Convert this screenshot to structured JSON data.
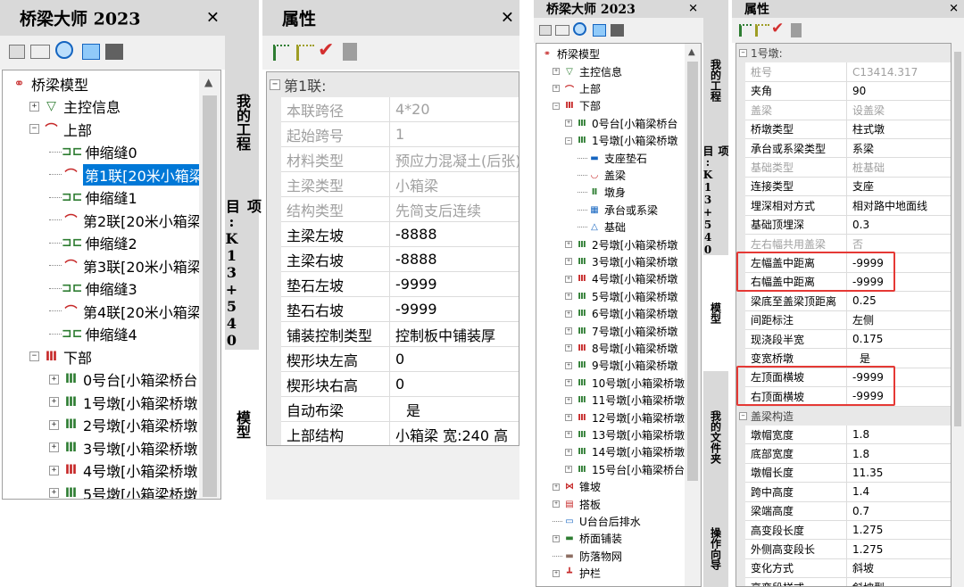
{
  "left": {
    "tree_title": "桥梁大师 2023",
    "props_title": "属性",
    "close": "✕",
    "tabs": [
      "我的工程",
      "项目:K13+540",
      "模型"
    ],
    "tree": [
      {
        "label": "桥梁模型",
        "icon": "bridge-model-icon",
        "glyph": "⚭",
        "color": "#c62828",
        "level": 0,
        "exp": ""
      },
      {
        "label": "主控信息",
        "icon": "main-control-icon",
        "glyph": "▽",
        "color": "#2e7d32",
        "level": 1,
        "exp": "+"
      },
      {
        "label": "上部",
        "icon": "superstructure-icon",
        "glyph": "⌒",
        "color": "#c62828",
        "level": 1,
        "exp": "−"
      },
      {
        "label": "伸缩缝0",
        "icon": "expansion-joint-icon",
        "glyph": "⊐⊏",
        "color": "#2e7d32",
        "level": 2,
        "exp": ""
      },
      {
        "label": "第1联[20米小箱梁",
        "icon": "span-icon",
        "glyph": "⌒",
        "color": "#c62828",
        "level": 2,
        "exp": "",
        "selected": true
      },
      {
        "label": "伸缩缝1",
        "icon": "expansion-joint-icon",
        "glyph": "⊐⊏",
        "color": "#2e7d32",
        "level": 2,
        "exp": ""
      },
      {
        "label": "第2联[20米小箱梁",
        "icon": "span-icon",
        "glyph": "⌒",
        "color": "#c62828",
        "level": 2,
        "exp": ""
      },
      {
        "label": "伸缩缝2",
        "icon": "expansion-joint-icon",
        "glyph": "⊐⊏",
        "color": "#2e7d32",
        "level": 2,
        "exp": ""
      },
      {
        "label": "第3联[20米小箱梁",
        "icon": "span-icon",
        "glyph": "⌒",
        "color": "#c62828",
        "level": 2,
        "exp": ""
      },
      {
        "label": "伸缩缝3",
        "icon": "expansion-joint-icon",
        "glyph": "⊐⊏",
        "color": "#2e7d32",
        "level": 2,
        "exp": ""
      },
      {
        "label": "第4联[20米小箱梁",
        "icon": "span-icon",
        "glyph": "⌒",
        "color": "#c62828",
        "level": 2,
        "exp": ""
      },
      {
        "label": "伸缩缝4",
        "icon": "expansion-joint-icon",
        "glyph": "⊐⊏",
        "color": "#2e7d32",
        "level": 2,
        "exp": ""
      },
      {
        "label": "下部",
        "icon": "substructure-icon",
        "glyph": "Ⅲ",
        "color": "#c62828",
        "level": 1,
        "exp": "−"
      },
      {
        "label": "0号台[小箱梁桥台",
        "icon": "abutment-icon",
        "glyph": "Ⅲ",
        "color": "#2e7d32",
        "level": 2,
        "exp": "+"
      },
      {
        "label": "1号墩[小箱梁桥墩",
        "icon": "pier-icon",
        "glyph": "Ⅲ",
        "color": "#2e7d32",
        "level": 2,
        "exp": "+"
      },
      {
        "label": "2号墩[小箱梁桥墩",
        "icon": "pier-icon",
        "glyph": "Ⅲ",
        "color": "#2e7d32",
        "level": 2,
        "exp": "+"
      },
      {
        "label": "3号墩[小箱梁桥墩",
        "icon": "pier-icon",
        "glyph": "Ⅲ",
        "color": "#2e7d32",
        "level": 2,
        "exp": "+"
      },
      {
        "label": "4号墩[小箱梁桥墩",
        "icon": "pier-icon",
        "glyph": "Ⅲ",
        "color": "#c62828",
        "level": 2,
        "exp": "+"
      },
      {
        "label": "5号墩[小箱梁桥墩",
        "icon": "pier-icon",
        "glyph": "Ⅲ",
        "color": "#2e7d32",
        "level": 2,
        "exp": "+"
      }
    ],
    "category": "第1联:",
    "props": [
      {
        "k": "本联跨径",
        "v": "4*20",
        "gray": true
      },
      {
        "k": "起始跨号",
        "v": "1",
        "gray": true
      },
      {
        "k": "材料类型",
        "v": "预应力混凝土(后张)",
        "gray": true
      },
      {
        "k": "主梁类型",
        "v": "小箱梁",
        "gray": true
      },
      {
        "k": "结构类型",
        "v": "先简支后连续",
        "gray": true
      },
      {
        "k": "主梁左坡",
        "v": "-8888",
        "gray": false
      },
      {
        "k": "主梁右坡",
        "v": "-8888",
        "gray": false
      },
      {
        "k": "垫石左坡",
        "v": "-9999",
        "gray": false
      },
      {
        "k": "垫石右坡",
        "v": "-9999",
        "gray": false
      },
      {
        "k": "铺装控制类型",
        "v": "控制板中铺装厚",
        "gray": false
      },
      {
        "k": "楔形块左高",
        "v": "0",
        "gray": false
      },
      {
        "k": "楔形块右高",
        "v": "0",
        "gray": false
      },
      {
        "k": "自动布梁",
        "v": "是",
        "gray": false,
        "center": true
      },
      {
        "k": "上部结构",
        "v": "小箱梁 宽:240 高",
        "gray": false
      }
    ]
  },
  "right": {
    "tree_title": "桥梁大师 2023",
    "props_title": "属性",
    "close": "✕",
    "tabs": [
      "我的工程",
      "项目:K13+540",
      "模型",
      "我的文件夹",
      "操作向导"
    ],
    "tree": [
      {
        "label": "桥梁模型",
        "icon": "bridge-model-icon",
        "glyph": "⚭",
        "color": "#c62828",
        "level": 0,
        "exp": ""
      },
      {
        "label": "主控信息",
        "icon": "main-control-icon",
        "glyph": "▽",
        "color": "#2e7d32",
        "level": 1,
        "exp": "+"
      },
      {
        "label": "上部",
        "icon": "superstructure-icon",
        "glyph": "⌒",
        "color": "#c62828",
        "level": 1,
        "exp": "+"
      },
      {
        "label": "下部",
        "icon": "substructure-icon",
        "glyph": "Ⅲ",
        "color": "#c62828",
        "level": 1,
        "exp": "−"
      },
      {
        "label": "0号台[小箱梁桥台",
        "icon": "abutment-icon",
        "glyph": "Ⅲ",
        "color": "#2e7d32",
        "level": 2,
        "exp": "+"
      },
      {
        "label": "1号墩[小箱梁桥墩",
        "icon": "pier-icon",
        "glyph": "Ⅲ",
        "color": "#2e7d32",
        "level": 2,
        "exp": "−"
      },
      {
        "label": "支座垫石",
        "icon": "bearing-pad-icon",
        "glyph": "▬",
        "color": "#1565c0",
        "level": 3,
        "exp": ""
      },
      {
        "label": "盖梁",
        "icon": "cap-beam-icon",
        "glyph": "◡",
        "color": "#c62828",
        "level": 3,
        "exp": ""
      },
      {
        "label": "墩身",
        "icon": "pier-body-icon",
        "glyph": "Ⅱ",
        "color": "#2e7d32",
        "level": 3,
        "exp": ""
      },
      {
        "label": "承台或系梁",
        "icon": "pile-cap-icon",
        "glyph": "▦",
        "color": "#1565c0",
        "level": 3,
        "exp": ""
      },
      {
        "label": "基础",
        "icon": "foundation-icon",
        "glyph": "△",
        "color": "#1565c0",
        "level": 3,
        "exp": ""
      },
      {
        "label": "2号墩[小箱梁桥墩",
        "icon": "pier-icon",
        "glyph": "Ⅲ",
        "color": "#2e7d32",
        "level": 2,
        "exp": "+"
      },
      {
        "label": "3号墩[小箱梁桥墩",
        "icon": "pier-icon",
        "glyph": "Ⅲ",
        "color": "#2e7d32",
        "level": 2,
        "exp": "+"
      },
      {
        "label": "4号墩[小箱梁桥墩",
        "icon": "pier-icon",
        "glyph": "Ⅲ",
        "color": "#c62828",
        "level": 2,
        "exp": "+"
      },
      {
        "label": "5号墩[小箱梁桥墩",
        "icon": "pier-icon",
        "glyph": "Ⅲ",
        "color": "#2e7d32",
        "level": 2,
        "exp": "+"
      },
      {
        "label": "6号墩[小箱梁桥墩",
        "icon": "pier-icon",
        "glyph": "Ⅲ",
        "color": "#2e7d32",
        "level": 2,
        "exp": "+"
      },
      {
        "label": "7号墩[小箱梁桥墩",
        "icon": "pier-icon",
        "glyph": "Ⅲ",
        "color": "#2e7d32",
        "level": 2,
        "exp": "+"
      },
      {
        "label": "8号墩[小箱梁桥墩",
        "icon": "pier-icon",
        "glyph": "Ⅲ",
        "color": "#c62828",
        "level": 2,
        "exp": "+"
      },
      {
        "label": "9号墩[小箱梁桥墩",
        "icon": "pier-icon",
        "glyph": "Ⅲ",
        "color": "#2e7d32",
        "level": 2,
        "exp": "+"
      },
      {
        "label": "10号墩[小箱梁桥墩",
        "icon": "pier-icon",
        "glyph": "Ⅲ",
        "color": "#2e7d32",
        "level": 2,
        "exp": "+"
      },
      {
        "label": "11号墩[小箱梁桥墩",
        "icon": "pier-icon",
        "glyph": "Ⅲ",
        "color": "#2e7d32",
        "level": 2,
        "exp": "+"
      },
      {
        "label": "12号墩[小箱梁桥墩",
        "icon": "pier-icon",
        "glyph": "Ⅲ",
        "color": "#c62828",
        "level": 2,
        "exp": "+"
      },
      {
        "label": "13号墩[小箱梁桥墩",
        "icon": "pier-icon",
        "glyph": "Ⅲ",
        "color": "#2e7d32",
        "level": 2,
        "exp": "+"
      },
      {
        "label": "14号墩[小箱梁桥墩",
        "icon": "pier-icon",
        "glyph": "Ⅲ",
        "color": "#2e7d32",
        "level": 2,
        "exp": "+"
      },
      {
        "label": "15号台[小箱梁桥台",
        "icon": "abutment-icon",
        "glyph": "Ⅲ",
        "color": "#2e7d32",
        "level": 2,
        "exp": "+"
      },
      {
        "label": "锥坡",
        "icon": "cone-slope-icon",
        "glyph": "⋈",
        "color": "#c62828",
        "level": 1,
        "exp": "+"
      },
      {
        "label": "搭板",
        "icon": "approach-slab-icon",
        "glyph": "▤",
        "color": "#c62828",
        "level": 1,
        "exp": "+"
      },
      {
        "label": "U台台后排水",
        "icon": "drainage-icon",
        "glyph": "▭",
        "color": "#1565c0",
        "level": 1,
        "exp": ""
      },
      {
        "label": "桥面铺装",
        "icon": "deck-paving-icon",
        "glyph": "▬",
        "color": "#2e7d32",
        "level": 1,
        "exp": "+"
      },
      {
        "label": "防落物网",
        "icon": "safety-net-icon",
        "glyph": "▬",
        "color": "#8d6e63",
        "level": 1,
        "exp": ""
      },
      {
        "label": "护栏",
        "icon": "guardrail-icon",
        "glyph": "┻",
        "color": "#c62828",
        "level": 1,
        "exp": "+"
      }
    ],
    "cat1": "1号墩:",
    "props1": [
      {
        "k": "桩号",
        "v": "C13414.317",
        "gray": true
      },
      {
        "k": "夹角",
        "v": "90",
        "gray": false
      },
      {
        "k": "盖梁",
        "v": "设盖梁",
        "gray": true
      },
      {
        "k": "桥墩类型",
        "v": "柱式墩",
        "gray": false
      },
      {
        "k": "承台或系梁类型",
        "v": "系梁",
        "gray": false
      },
      {
        "k": "基础类型",
        "v": "桩基础",
        "gray": true
      },
      {
        "k": "连接类型",
        "v": "支座",
        "gray": false
      },
      {
        "k": "埋深相对方式",
        "v": "相对路中地面线",
        "gray": false
      },
      {
        "k": "基础顶埋深",
        "v": "0.3",
        "gray": false
      },
      {
        "k": "左右幅共用盖梁",
        "v": "否",
        "gray": true
      },
      {
        "k": "左幅盖中距离",
        "v": "-9999",
        "gray": false
      },
      {
        "k": "右幅盖中距离",
        "v": "-9999",
        "gray": false
      },
      {
        "k": "梁底至盖梁顶距离",
        "v": "0.25",
        "gray": false
      },
      {
        "k": "间距标注",
        "v": "左侧",
        "gray": false
      },
      {
        "k": "现浇段半宽",
        "v": "0.175",
        "gray": false
      },
      {
        "k": "变宽桥墩",
        "v": "是",
        "gray": false,
        "center": true
      },
      {
        "k": "左顶面横坡",
        "v": "-9999",
        "gray": false
      },
      {
        "k": "右顶面横坡",
        "v": "-9999",
        "gray": false
      }
    ],
    "cat2": "盖梁构造",
    "props2": [
      {
        "k": "墩帽宽度",
        "v": "1.8",
        "gray": false
      },
      {
        "k": "底部宽度",
        "v": "1.8",
        "gray": false
      },
      {
        "k": "墩帽长度",
        "v": "11.35",
        "gray": false
      },
      {
        "k": "跨中高度",
        "v": "1.4",
        "gray": false
      },
      {
        "k": "梁端高度",
        "v": "0.7",
        "gray": false
      },
      {
        "k": "高变段长度",
        "v": "1.275",
        "gray": false
      },
      {
        "k": "外侧高变段长",
        "v": "1.275",
        "gray": false
      },
      {
        "k": "变化方式",
        "v": "斜坡",
        "gray": false
      },
      {
        "k": "高变段样式",
        "v": "斜坡型",
        "gray": false
      }
    ]
  },
  "colors": {
    "selection": "#0078d7",
    "highlight_box": "#e53935"
  }
}
